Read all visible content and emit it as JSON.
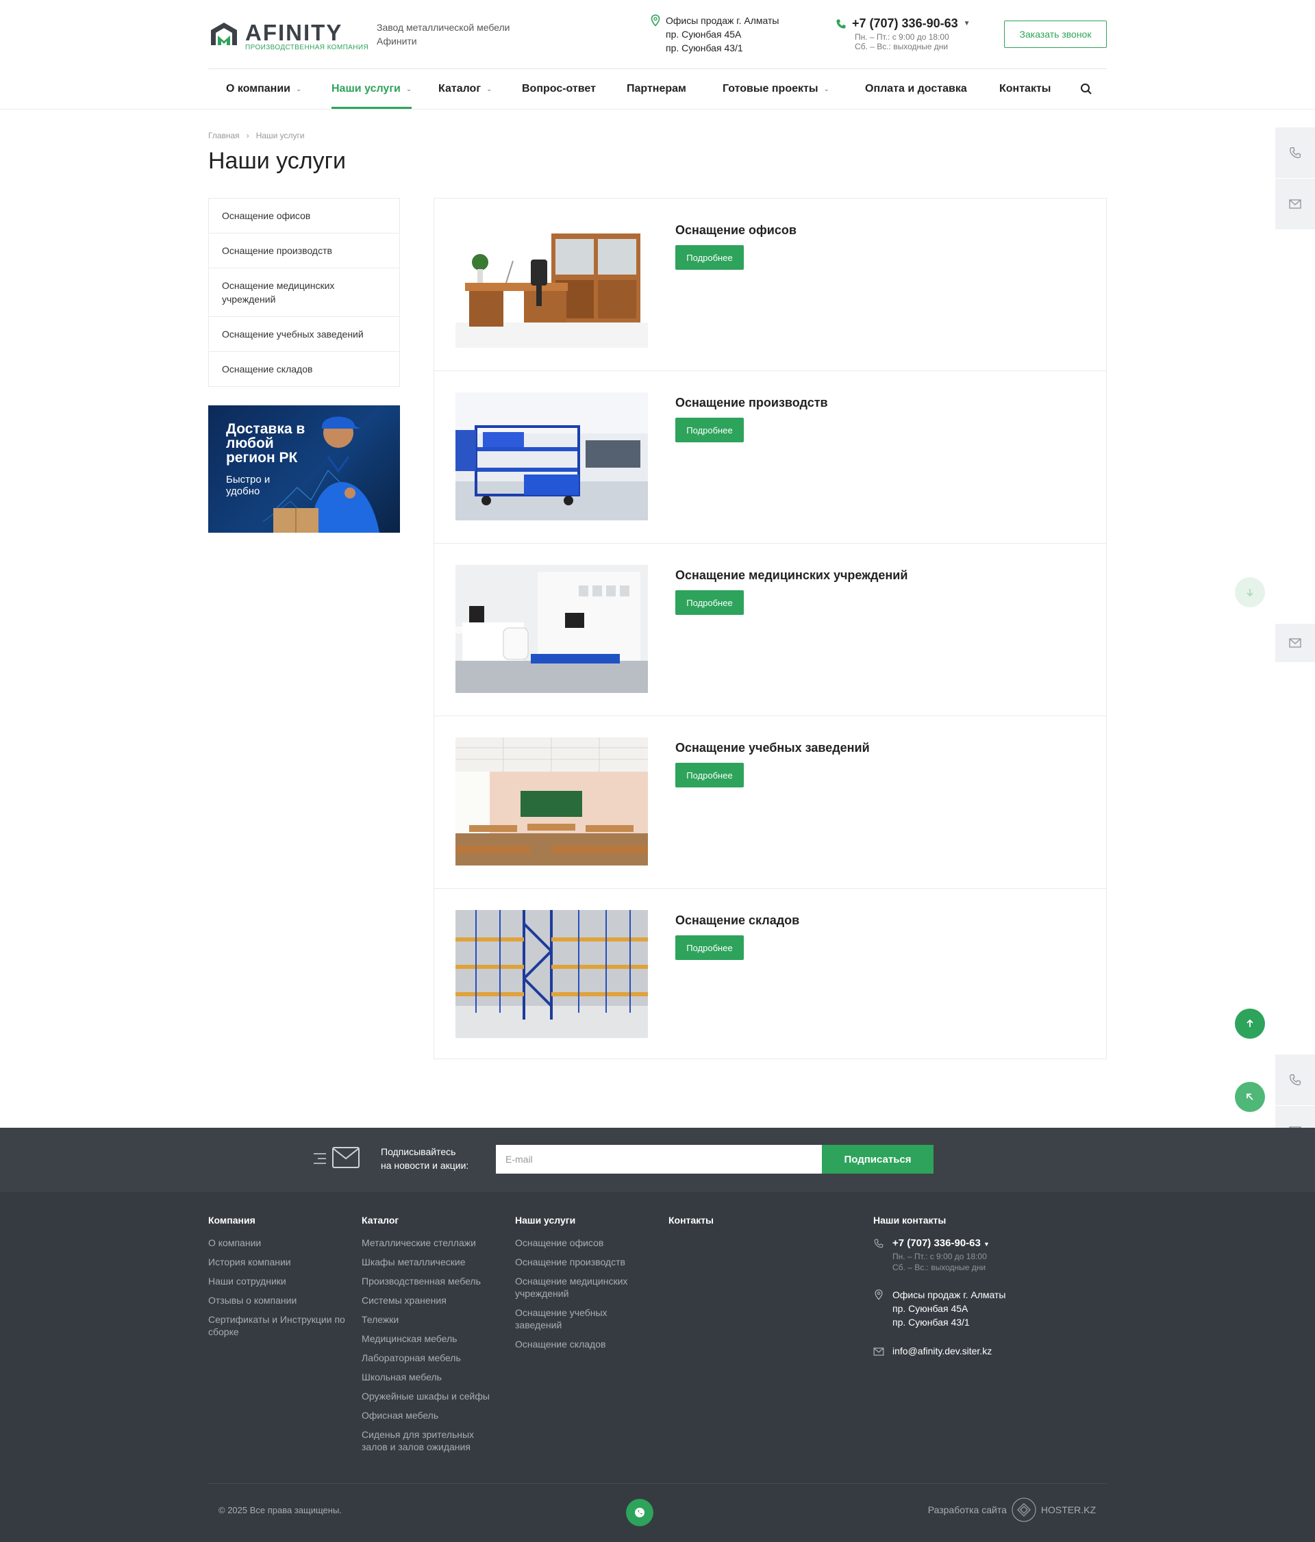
{
  "brand": {
    "logo_word": "AFINITY",
    "logo_sub": "ПРОИЗВОДСТВЕННАЯ КОМПАНИЯ",
    "tagline": "Завод металлической мебели Афинити",
    "accent": "#2ea35b",
    "dark": "#363b41"
  },
  "header": {
    "office_lines": [
      "Офисы продаж г. Алматы",
      "пр. Суюнбая 45А",
      "пр. Суюнбая 43/1"
    ],
    "phone": "+7 (707) 336-90-63",
    "hours_1": "Пн. – Пт.: с 9:00 до 18:00",
    "hours_2": "Сб. – Вс.: выходные дни",
    "callback_label": "Заказать звонок"
  },
  "nav": {
    "items": [
      {
        "label": "О компании"
      },
      {
        "label": "Наши услуги"
      },
      {
        "label": "Каталог"
      },
      {
        "label": "Вопрос-ответ"
      },
      {
        "label": "Партнерам"
      },
      {
        "label": "Готовые проекты"
      },
      {
        "label": "Оплата и доставка"
      },
      {
        "label": "Контакты"
      }
    ],
    "active": "Наши услуги"
  },
  "breadcrumb": {
    "home": "Главная",
    "sep": "›",
    "current": "Наши услуги"
  },
  "page_title": "Наши услуги",
  "sidebar": {
    "items": [
      {
        "label": "Оснащение офисов"
      },
      {
        "label": "Оснащение производств"
      },
      {
        "label": "Оснащение медицинских учреждений"
      },
      {
        "label": "Оснащение учебных заведений"
      },
      {
        "label": "Оснащение складов"
      }
    ],
    "promo_title": "Доставка в любой регион РК",
    "promo_sub": "Быстро и удобно"
  },
  "services": {
    "more_label": "Подробнее",
    "items": [
      {
        "title": "Оснащение офисов",
        "image": "office-furniture"
      },
      {
        "title": "Оснащение производств",
        "image": "production-carts"
      },
      {
        "title": "Оснащение медицинских учреждений",
        "image": "medical-room"
      },
      {
        "title": "Оснащение учебных заведений",
        "image": "classroom"
      },
      {
        "title": "Оснащение складов",
        "image": "warehouse-racks"
      }
    ]
  },
  "subscribe": {
    "text_1": "Подписывайтесь",
    "text_2": "на новости и акции:",
    "placeholder": "E-mail",
    "button": "Подписаться"
  },
  "footer": {
    "company": {
      "title": "Компания",
      "links": [
        "О компании",
        "История компании",
        "Наши сотрудники",
        "Отзывы о компании",
        "Сертификаты и Инструкции по сборке"
      ]
    },
    "catalog": {
      "title": "Каталог",
      "links": [
        "Металлические стеллажи",
        "Шкафы металлические",
        "Производственная мебель",
        "Системы хранения",
        "Тележки",
        "Медицинская мебель",
        "Лабораторная мебель",
        "Школьная мебель",
        "Оружейные шкафы и сейфы",
        "Офисная мебель",
        "Сиденья для зрительных залов и залов ожидания"
      ]
    },
    "services": {
      "title": "Наши услуги",
      "links": [
        "Оснащение офисов",
        "Оснащение производств",
        "Оснащение медицинских учреждений",
        "Оснащение учебных заведений",
        "Оснащение складов"
      ]
    },
    "contacts_title": "Контакты",
    "our_contacts": {
      "title": "Наши контакты",
      "phone": "+7 (707) 336-90-63",
      "hours_1": "Пн. – Пт.: с 9:00 до 18:00",
      "hours_2": "Сб. – Вс.: выходные дни",
      "office_1": "Офисы продаж г. Алматы",
      "office_2": "пр. Суюнбая 45А",
      "office_3": "пр. Суюнбая 43/1",
      "email": "info@afinity.dev.siter.kz"
    },
    "copyright": "© 2025 Все права защищены.",
    "dev_label": "Разработка сайта",
    "dev_brand": "HOSTER.KZ"
  }
}
